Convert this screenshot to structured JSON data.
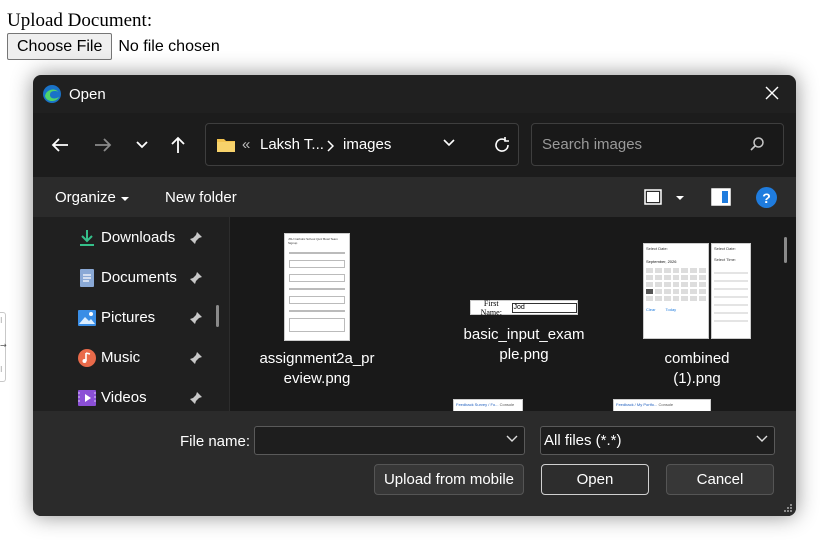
{
  "page": {
    "label": "Upload Document:",
    "choose_button": "Choose File",
    "no_file_text": "No file chosen"
  },
  "dialog": {
    "title": "Open",
    "address": {
      "overflow": "«",
      "crumbs": [
        "Laksh T...",
        "images"
      ]
    },
    "search": {
      "placeholder": "Search images"
    },
    "toolbar": {
      "organize": "Organize",
      "new_folder": "New folder"
    },
    "sidebar": {
      "items": [
        {
          "label": "Downloads",
          "icon": "download-icon"
        },
        {
          "label": "Documents",
          "icon": "document-icon"
        },
        {
          "label": "Pictures",
          "icon": "pictures-icon"
        },
        {
          "label": "Music",
          "icon": "music-icon"
        },
        {
          "label": "Videos",
          "icon": "videos-icon"
        }
      ]
    },
    "files": [
      {
        "name_line1": "assignment2a_pr",
        "name_line2": "eview.png"
      },
      {
        "name_line1": "basic_input_exam",
        "name_line2": "ple.png"
      },
      {
        "name_line1": "combined",
        "name_line2": "(1).png"
      }
    ],
    "thumb_text": {
      "first_name_label": "First Name:",
      "first_name_value": "Jod",
      "assignment_title": "JSU Catholic School Quiz Bowl Team Signup",
      "calendar_month": "September, 2026",
      "select_date": "Select Date:",
      "select_time": "Select Time:",
      "clear": "Clear",
      "today": "Today",
      "tab_title": "Feedback Survey / Fo...",
      "tab_title_2": "Feedback / My Portfo...",
      "console_label": "Console"
    },
    "file_name_label": "File name:",
    "file_name_value": "",
    "file_type": "All files (*.*)",
    "buttons": {
      "upload_mobile": "Upload from mobile",
      "open": "Open",
      "cancel": "Cancel"
    },
    "colors": {
      "accent": "#1f7cde",
      "background": "#202020",
      "bottom": "#2b2b2b"
    }
  }
}
